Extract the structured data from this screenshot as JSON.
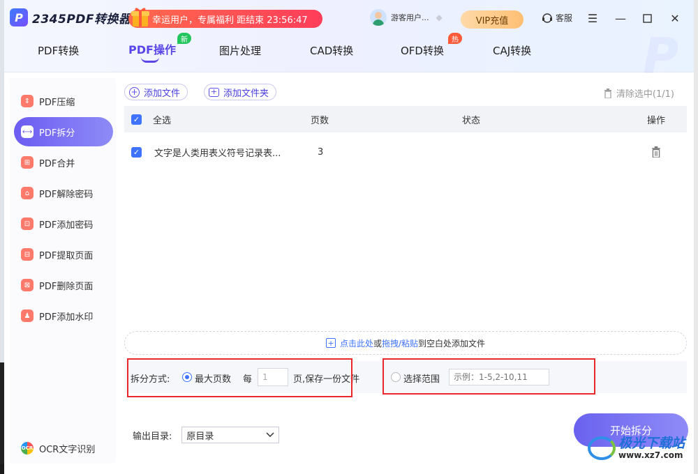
{
  "app": {
    "logo_letter": "P",
    "name": "2345PDF转换器"
  },
  "promo": {
    "text": "幸运用户，专属福利 距结束 23:56:47"
  },
  "user": {
    "name": "游客用户..."
  },
  "header": {
    "vip_label": "VIP充值",
    "service_label": "客服"
  },
  "tabs": [
    {
      "label": "PDF转换"
    },
    {
      "label": "PDF操作",
      "badge": "新"
    },
    {
      "label": "图片处理"
    },
    {
      "label": "CAD转换"
    },
    {
      "label": "OFD转换",
      "badge": "热"
    },
    {
      "label": "CAJ转换"
    }
  ],
  "sidebar": {
    "items": [
      {
        "label": "PDF压缩"
      },
      {
        "label": "PDF拆分"
      },
      {
        "label": "PDF合并"
      },
      {
        "label": "PDF解除密码"
      },
      {
        "label": "PDF添加密码"
      },
      {
        "label": "PDF提取页面"
      },
      {
        "label": "PDF删除页面"
      },
      {
        "label": "PDF添加水印"
      }
    ],
    "ocr": {
      "icon_text": "OCR",
      "label": "OCR文字识别"
    }
  },
  "toolbar": {
    "add_file": "添加文件",
    "add_folder": "添加文件夹",
    "clear_selected": "清除选中(1/1)"
  },
  "table": {
    "headers": {
      "select_all": "全选",
      "pages": "页数",
      "status": "状态",
      "actions": "操作"
    },
    "rows": [
      {
        "name": "文字是人类用表义符号记录表...",
        "pages": "3",
        "status": ""
      }
    ]
  },
  "dropzone": {
    "part1": "点击此处",
    "part2": "或",
    "part3": "拖拽/粘贴",
    "part4": "到空白处添加文件"
  },
  "split": {
    "label": "拆分方式:",
    "max_pages": "最大页数",
    "every": "每",
    "value": "1",
    "suffix": "页,保存一份文件",
    "range_label": "选择范围",
    "range_placeholder": "示例：1-5,2-10,11"
  },
  "output": {
    "label": "输出目录:",
    "value": "原目录"
  },
  "start_button": "开始拆分",
  "site": {
    "name": "极光下载站",
    "url": "www.xz7.com"
  },
  "colors": {
    "accent": "#5a46e8",
    "highlight": "#e8282b",
    "promo": "#ff3d5a"
  }
}
